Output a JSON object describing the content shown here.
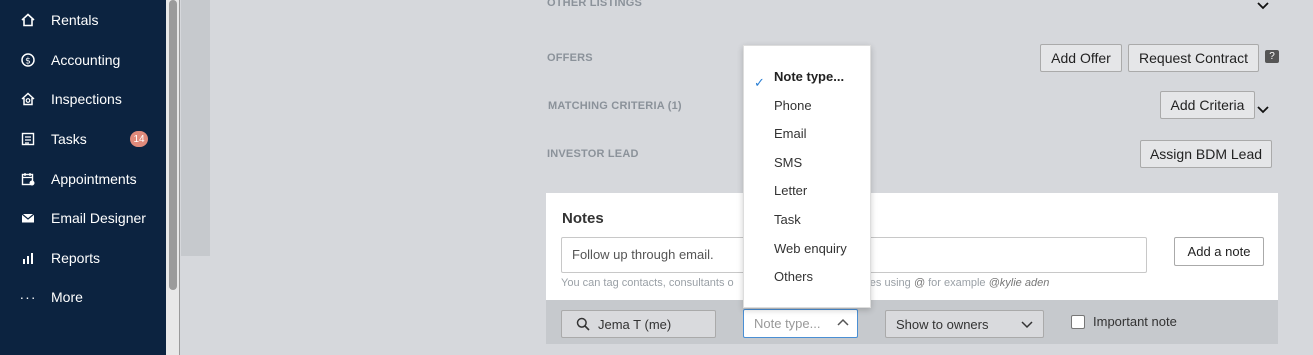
{
  "sidebar": {
    "items": [
      {
        "label": "Rentals",
        "icon": "home-icon"
      },
      {
        "label": "Accounting",
        "icon": "dollar-icon"
      },
      {
        "label": "Inspections",
        "icon": "house-search-icon"
      },
      {
        "label": "Tasks",
        "icon": "tasks-icon",
        "badge": "14"
      },
      {
        "label": "Appointments",
        "icon": "calendar-icon"
      },
      {
        "label": "Email Designer",
        "icon": "envelope-icon"
      },
      {
        "label": "Reports",
        "icon": "bar-chart-icon"
      },
      {
        "label": "More",
        "icon": "more-icon"
      }
    ]
  },
  "sections": {
    "other_listings": "OTHER LISTINGS",
    "offers": "OFFERS",
    "matching_criteria": "MATCHING CRITERIA (1)",
    "investor_lead": "INVESTOR LEAD"
  },
  "buttons": {
    "add_offer": "Add Offer",
    "request_contract": "Request Contract",
    "add_criteria": "Add Criteria",
    "assign_bdm_lead": "Assign BDM Lead",
    "add_note": "Add a note"
  },
  "notes": {
    "title": "Notes",
    "input_value": "Follow up through email.",
    "help_prefix": "You can tag contacts, consultants o",
    "help_middle": "es using",
    "help_at": "@",
    "help_for_example": "for example",
    "help_example": "@kylie aden"
  },
  "toolbar": {
    "user": "Jema T (me)",
    "note_type_placeholder": "Note type...",
    "show_to": "Show to owners",
    "important": "Important note"
  },
  "note_type_options": [
    "Note type...",
    "Phone",
    "Email",
    "SMS",
    "Letter",
    "Task",
    "Web enquiry",
    "Others"
  ],
  "colors": {
    "sidebar_bg": "#0c2340",
    "badge_bg": "#e08a7b",
    "check_accent": "#2a7fd4"
  }
}
